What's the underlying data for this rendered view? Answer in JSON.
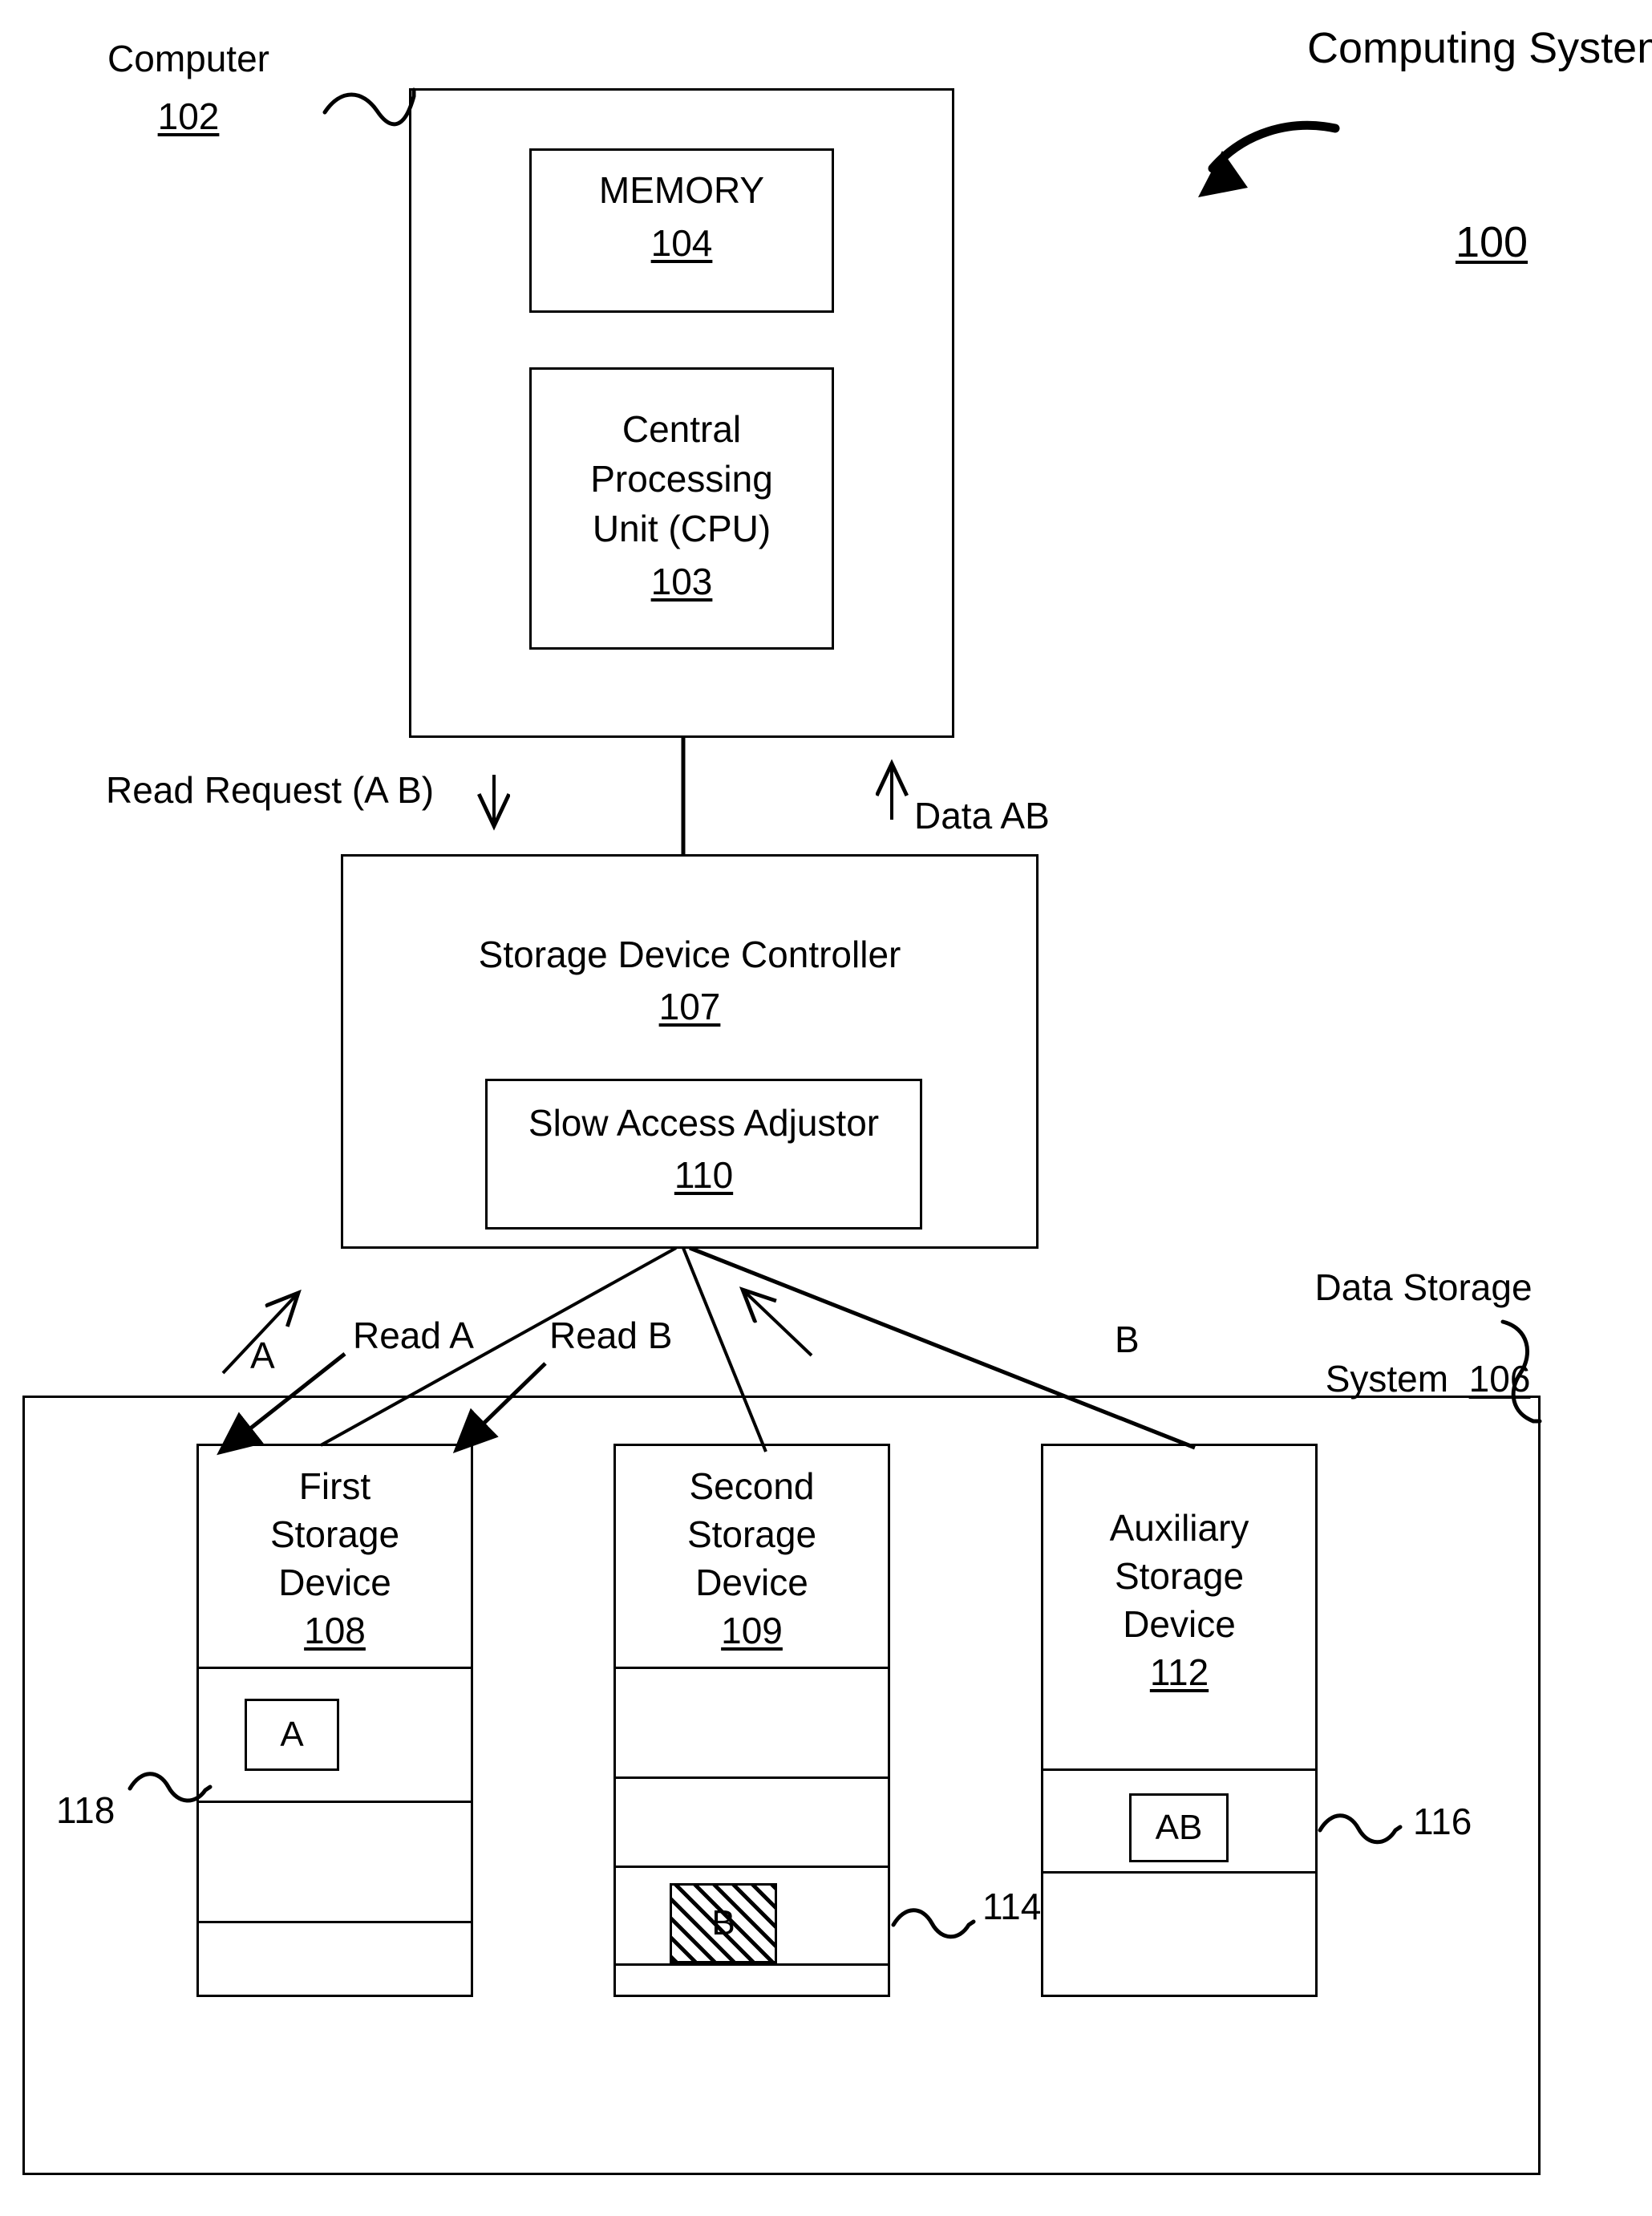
{
  "figure": {
    "title_label": "Computing System",
    "title_number": "100"
  },
  "computer": {
    "label": "Computer",
    "number": "102",
    "memory": {
      "label": "MEMORY",
      "number": "104"
    },
    "cpu": {
      "line1": "Central",
      "line2": "Processing",
      "line3": "Unit (CPU)",
      "number": "103"
    }
  },
  "bus": {
    "read_request_label": "Read Request (A B)",
    "read_request_arrow": "down-arrow-icon",
    "data_label": "Data AB",
    "data_arrow": "up-arrow-icon"
  },
  "controller": {
    "label": "Storage Device Controller",
    "number": "107",
    "adjustor": {
      "label": "Slow Access Adjustor",
      "number": "110"
    }
  },
  "flows": {
    "a_label": "A",
    "read_a_label": "Read A",
    "read_b_label": "Read B",
    "b_label": "B"
  },
  "data_storage_system": {
    "label_line1": "Data Storage",
    "label_line2": "System",
    "number": "106",
    "devices": [
      {
        "name": "first-storage-device",
        "line1": "First",
        "line2": "Storage",
        "line3": "Device",
        "number": "108",
        "block_label": "A",
        "block_hatched": false,
        "callout": "118",
        "sectors": 4
      },
      {
        "name": "second-storage-device",
        "line1": "Second",
        "line2": "Storage",
        "line3": "Device",
        "number": "109",
        "block_label": "B",
        "block_hatched": true,
        "callout": "114",
        "sectors": 4
      },
      {
        "name": "auxiliary-storage-device",
        "line1": "Auxiliary",
        "line2": "Storage",
        "line3": "Device",
        "number": "112",
        "block_label": "AB",
        "block_hatched": false,
        "callout": "116",
        "sectors": 2
      }
    ]
  },
  "colors": {
    "ink": "#000000",
    "paper": "#ffffff"
  }
}
